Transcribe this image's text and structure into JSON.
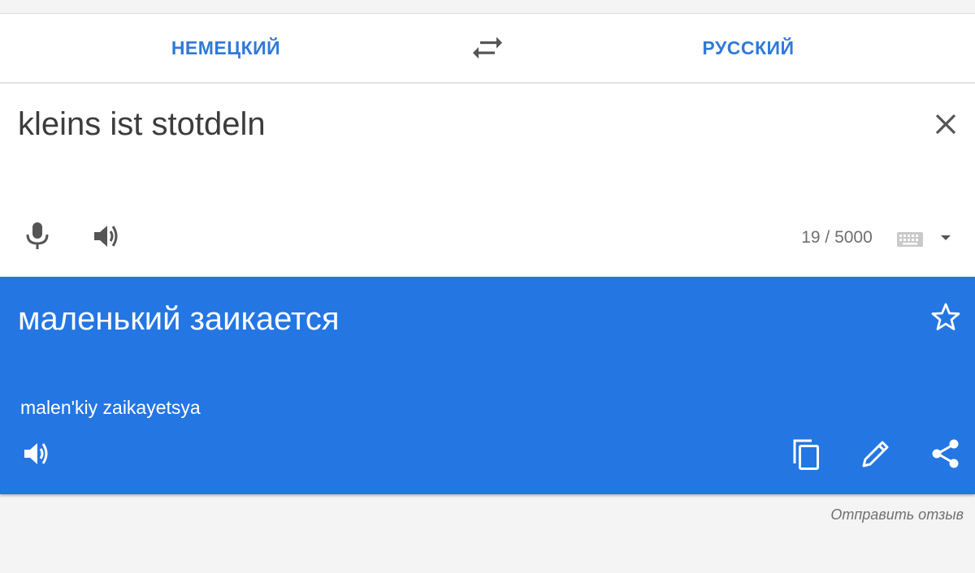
{
  "language_bar": {
    "source_language": "НЕМЕЦКИЙ",
    "target_language": "РУССКИЙ",
    "swap_icon": "swap-arrows-icon"
  },
  "input": {
    "text": "kleins ist stotdeln",
    "char_count": "19 / 5000",
    "icons": [
      "close-icon",
      "microphone-icon",
      "speaker-icon",
      "keyboard-icon",
      "dropdown-arrow-icon"
    ]
  },
  "result": {
    "translation": "маленький заикается",
    "transliteration": "malen'kiy zaikayetsya",
    "icons": [
      "star-outline-icon",
      "speaker-icon",
      "copy-icon",
      "pencil-icon",
      "share-icon"
    ]
  },
  "footer": {
    "feedback_label": "Отправить отзыв"
  },
  "colors": {
    "accent_blue": "#2476e3",
    "language_text": "#2f7ad9",
    "background": "#f4f4f4"
  }
}
